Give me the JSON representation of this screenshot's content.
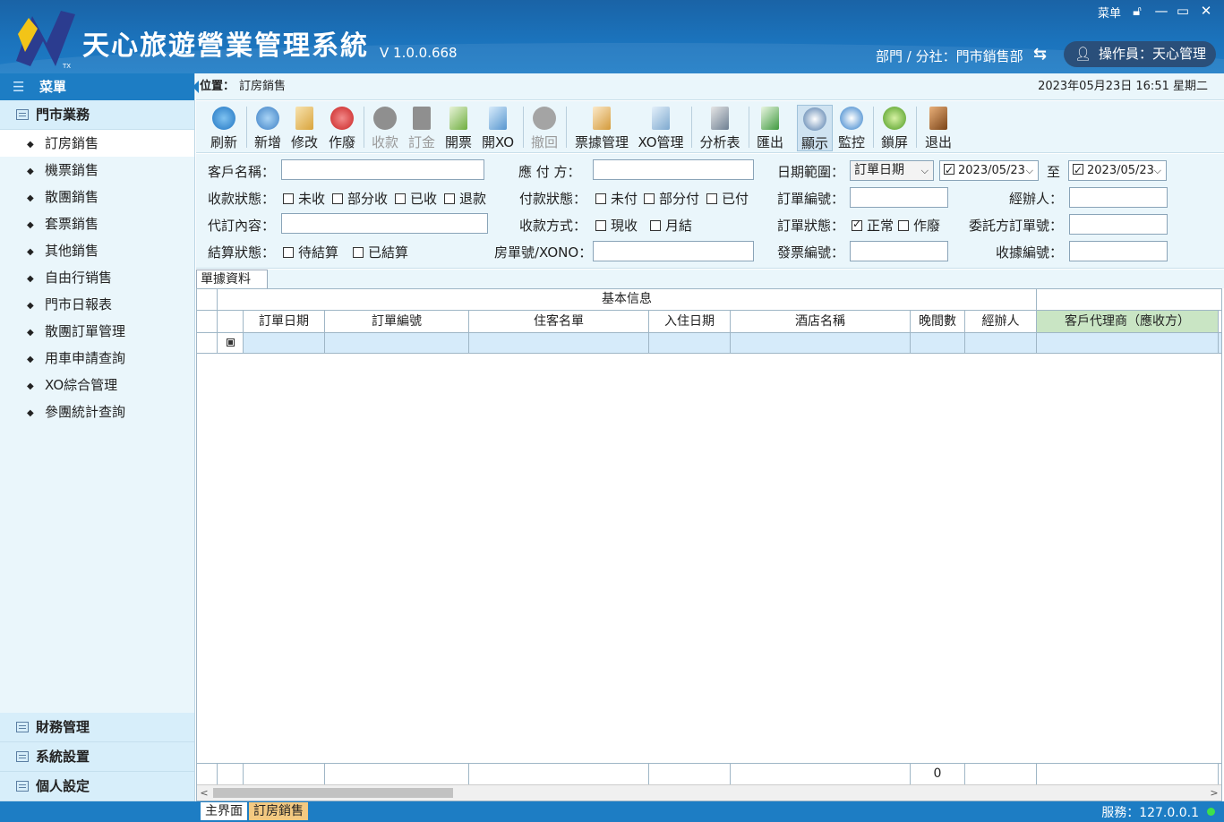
{
  "app": {
    "title": "天心旅遊營業管理系統",
    "version": "V 1.0.0.668",
    "top_menu_label": "菜单",
    "department": "部門 / 分社：門市銷售部",
    "operator": "操作員：天心管理"
  },
  "sidebar": {
    "header": "菜單",
    "groups": [
      {
        "label": "門市業務",
        "items": [
          "訂房銷售",
          "機票銷售",
          "散團銷售",
          "套票銷售",
          "其他銷售",
          "自由行销售",
          "門市日報表",
          "散團訂單管理",
          "用車申請查詢",
          "XO綜合管理",
          "參團統計查詢"
        ]
      },
      {
        "label": "財務管理"
      },
      {
        "label": "系統設置"
      },
      {
        "label": "個人設定"
      }
    ]
  },
  "location": {
    "label": "位置：",
    "value": "訂房銷售",
    "datetime": "2023年05月23日 16:51  星期二"
  },
  "toolbar": {
    "refresh": "刷新",
    "add": "新增",
    "edit": "修改",
    "void": "作廢",
    "collect": "收款",
    "deposit": "訂金",
    "invoice": "開票",
    "open_xo": "開XO",
    "withdraw": "撤回",
    "ticket_mgmt": "票據管理",
    "xo_mgmt": "XO管理",
    "analysis": "分析表",
    "export": "匯出",
    "display": "顯示",
    "monitor": "監控",
    "lock": "鎖屏",
    "exit": "退出"
  },
  "filters": {
    "customer_name_label": "客戶名稱：",
    "collect_status_label": "收款狀態：",
    "collect_status_options": [
      "未收",
      "部分收",
      "已收",
      "退款"
    ],
    "agent_content_label": "代訂內容：",
    "settle_status_label": "結算狀態：",
    "settle_status_options": [
      "待結算",
      "已結算"
    ],
    "payable_label": "應 付 方：",
    "pay_status_label": "付款狀態：",
    "pay_status_options": [
      "未付",
      "部分付",
      "已付"
    ],
    "pay_method_label": "收款方式：",
    "pay_method_options": [
      "現收",
      "月結"
    ],
    "room_no_label": "房單號/XONO：",
    "date_range_label": "日期範圍：",
    "date_type": "訂單日期",
    "date_from": "2023/05/23",
    "date_to_sep": "至",
    "date_to": "2023/05/23",
    "order_no_label": "訂單編號：",
    "order_status_label": "訂單狀態：",
    "order_status_options": [
      "正常",
      "作廢"
    ],
    "invoice_no_label": "發票編號：",
    "handler_label": "經辦人：",
    "client_order_label": "委託方訂單號：",
    "receipt_no_label": "收據編號："
  },
  "grid": {
    "tab": "單據資料",
    "group_header": "基本信息",
    "columns": [
      "訂單日期",
      "訂單編號",
      "住客名單",
      "入住日期",
      "酒店名稱",
      "晚間數",
      "經辦人",
      "客戶代理商（應收方）"
    ],
    "nights_total": "0"
  },
  "status": {
    "tabs": [
      "主界面",
      "訂房銷售"
    ],
    "server": "服務：127.0.0.1"
  }
}
